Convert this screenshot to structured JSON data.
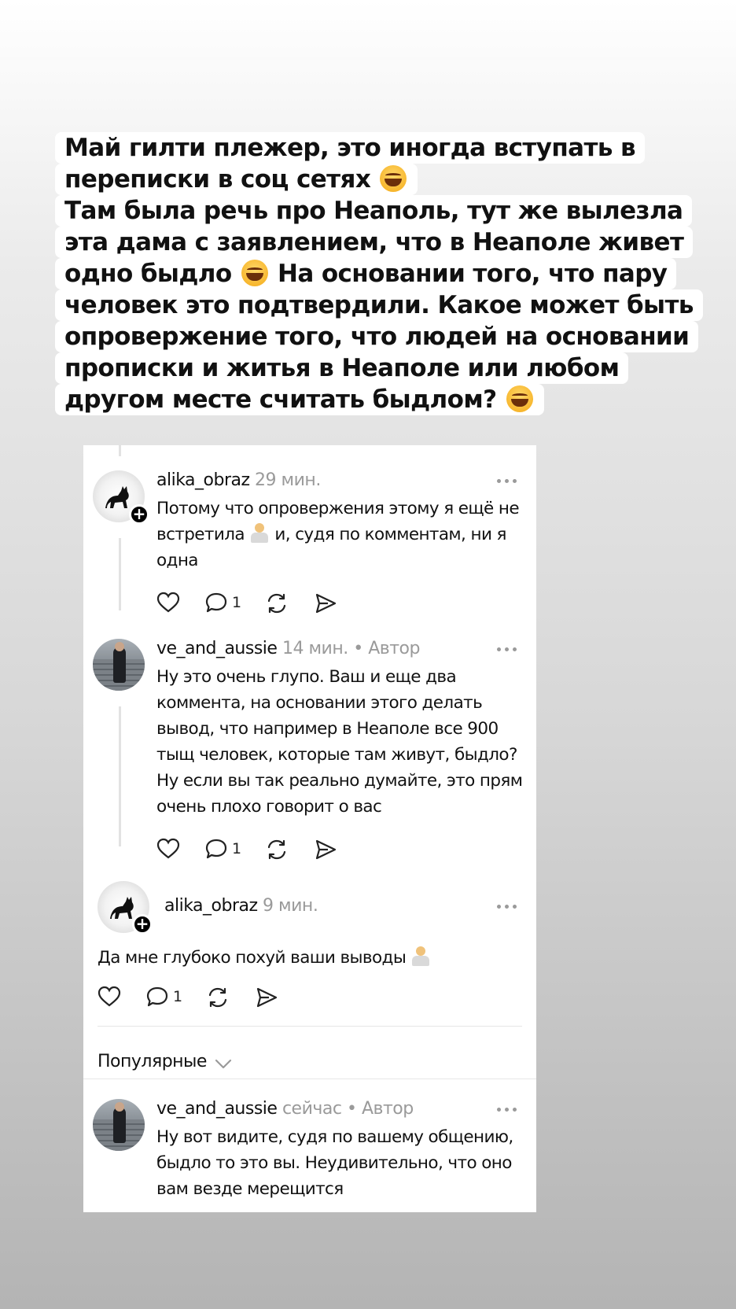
{
  "caption": {
    "lines": [
      "Май гилти плежер, это иногда вступать в",
      "переписки в соц сетях",
      "Там была речь про Неаполь, тут же вылезла",
      "эта дама с заявлением, что в Неаполе живет",
      "одно быдло",
      "На основании того, что пару",
      "человек это подтвердили. Какое может быть",
      "опровержение того, что людей на основании",
      "прописки и житья в Неаполе или любом",
      "другом месте считать быдлом?"
    ],
    "emoji": "grinning-squinting-face"
  },
  "comments": [
    {
      "username": "alika_obraz",
      "time": "29 мин.",
      "text_line1": "Потому что опровержения этому я ещё не",
      "text_line2a": "встретила",
      "text_line2b": " и, судя по комментам, ни я",
      "text_line3": "одна",
      "emoji": "person-shrugging",
      "replies": "1"
    },
    {
      "username": "ve_and_aussie",
      "time": "14 мин.",
      "dot": "•",
      "author": "Автор",
      "text_lines": [
        "Ну это очень глупо. Ваш и еще два",
        "коммента, на основании этого делать",
        "вывод, что например в Неаполе все 900",
        "тыщ человек, которые там живут, быдло?",
        "Ну если вы так реально думайте, это прям",
        "очень плохо говорит о вас"
      ],
      "replies": "1"
    },
    {
      "username": "alika_obraz",
      "time": "9 мин.",
      "text": "Да мне глубоко похуй ваши выводы",
      "emoji": "person-shrugging",
      "replies": "1"
    },
    {
      "username": "ve_and_aussie",
      "time": "сейчас",
      "dot": "•",
      "author": "Автор",
      "text_lines": [
        "Ну вот видите, судя по вашему общению,",
        "быдло то это вы. Неудивительно, что оно",
        "вам везде мерещится"
      ]
    }
  ],
  "sort": {
    "label": "Популярные"
  },
  "icons": [
    "heart-icon",
    "comment-icon",
    "repost-icon",
    "share-icon",
    "more-icon",
    "plus-icon",
    "chevron-down-icon"
  ]
}
